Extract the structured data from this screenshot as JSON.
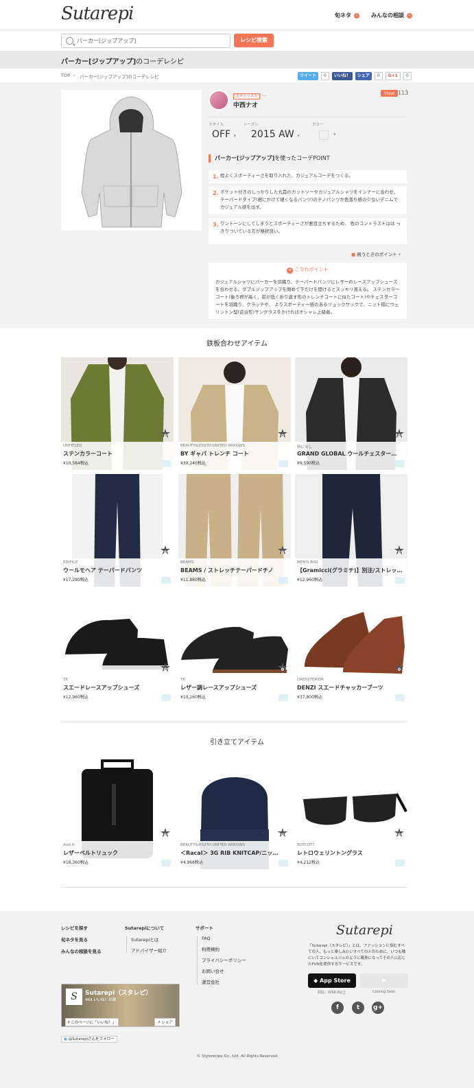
{
  "header": {
    "logo": "Sutarepi",
    "nav": [
      {
        "label": "旬ネタ",
        "icon": "chevron-right-icon"
      },
      {
        "label": "みんなの相談",
        "icon": "chevron-right-icon"
      }
    ]
  },
  "search": {
    "value": "パーカー[ジップアップ]",
    "button": "レシピ検索"
  },
  "band": {
    "bold": "パーカー[ジップアップ]",
    "rest": "のコーデレシピ"
  },
  "breadcrumb": {
    "top": "TOP",
    "sep": "›",
    "current": "パーカー[ジップアップ]のコーデレシピ"
  },
  "social": {
    "tweet": "ツイート",
    "tweet_count": "0",
    "like": "いいね！",
    "share": "シェア",
    "fb_count": "0",
    "gplus": "G+1",
    "gplus_count": "0"
  },
  "stylist": {
    "tag": "スタイリスト",
    "extra": "- -",
    "name": "中西ナオ"
  },
  "view": {
    "label": "View",
    "count": "113"
  },
  "attrs": [
    {
      "label": "スタイル",
      "value": "OFF"
    },
    {
      "label": "シーズン",
      "value": "2015 AW"
    },
    {
      "label": "カラー",
      "value": ""
    }
  ],
  "point": {
    "heading_bold": "パーカー[ジップアップ]",
    "heading_rest": "を使ったコーデPOINT",
    "items": [
      {
        "num": "1.",
        "text": "程よくスポーティーさを取り入れた、カジュアルコーデをつくる。"
      },
      {
        "num": "2.",
        "text": "ポケット付きのしっかりした丸首のカットソーやカジュアルシャツをインナーに合わせ、テーパードタイプ(裾にかけて細くなるパンツ)のチノパンツか色落ち感の少ないデニムで カジュアル感を出す。"
      },
      {
        "num": "3.",
        "text": "ワントーンにしてしまうとスポーティーさが悪目立ちするため、 色のコントラストはは っきりついている方が格好良い。"
      }
    ],
    "buy_point": "買うときのポイント"
  },
  "kodawari": {
    "title": "こなれポイント",
    "text": "カジュアルシャツにパーカーを羽織り、テーパードパンツにレザーのレースアップシューズを合わせる。ダブルジップアップを閉めて下だけを開けるとスッキリ見える。 ステンカラーコート(後ろ襟が高く、前が低く折り返す形のトレンチコートに似たコート)やチェスターコートを羽織り、クラッチや、 よりスポーティー感のあるリュックサックで、ニット帽にウェリントン型(逆台形)サングラスをかければオシャレ上級者。"
  },
  "section1": {
    "title": "鉄板合わせアイテム",
    "items": [
      {
        "brand": "UNTITLED",
        "name": "ステンカラーコート",
        "price": "¥10,584税込",
        "likes": "0"
      },
      {
        "brand": "BEAUTY&YOUTH UNITED ARROWS",
        "name": "BY ギャバ トレンチ コート",
        "price": "¥30,240税込",
        "likes": "0"
      },
      {
        "brand": "特になし",
        "name": "GRAND GLOBAL ウールチェスター…",
        "price": "¥9,590税込",
        "likes": "0"
      },
      {
        "brand": "EDIFICE",
        "name": "ウールモヘア テーパードパンツ",
        "price": "¥17,280税込",
        "likes": "0"
      },
      {
        "brand": "BEAMS",
        "name": "BEAMS / ストレッチテーパードチノ",
        "price": "¥11,880税込",
        "likes": "0"
      },
      {
        "brand": "MEN'S BIGI",
        "name": "【Gramicci(グラミチ)】別注/ストレッチ…",
        "price": "¥12,960税込",
        "likes": "0"
      },
      {
        "brand": "TK",
        "name": "スエードレースアップシューズ",
        "price": "¥12,960税込",
        "likes": "0"
      },
      {
        "brand": "TK",
        "name": "レザー調レースアップシューズ",
        "price": "¥10,260税込",
        "likes": "0"
      },
      {
        "brand": "DRESSTERIOR",
        "name": "DENZI スエードチャッカーブーツ",
        "price": "¥37,800税込",
        "likes": "0"
      }
    ]
  },
  "section2": {
    "title": "引き立てアイテム",
    "items": [
      {
        "brand": "And A",
        "name": "レザーベルトリュック",
        "price": "¥18,360税込",
        "likes": "0"
      },
      {
        "brand": "BEAUTY&YOUTH UNITED ARROWS",
        "name": "＜Racal＞ 3G RIB KNITCAP/ニッ…",
        "price": "¥4,968税込",
        "likes": "0"
      },
      {
        "brand": "BOYCOTT",
        "name": "レトロウェリントングラス",
        "price": "¥4,212税込",
        "likes": "0"
      }
    ]
  },
  "footer": {
    "col1": [
      "レシピを探す",
      "旬ネタを見る",
      "みんなの相談を見る"
    ],
    "col2_title": "Sutarepiについて",
    "col2": [
      "Sutarepiとは",
      "アドバイザー紹介"
    ],
    "col3_title": "サポート",
    "col3": [
      "FAQ",
      "利用規約",
      "プライバシーポリシー",
      "お問い合せ",
      "運営会社"
    ],
    "logo": "Sutarepi",
    "desc": "「Sutarepi（スタレピ）」とは、ファッションに悩むすべての人、もっと楽しみたいすべての人のために、いつも隣にいてコンシェルジュのように親身になってその人に応じたFUNを提供するサービスです。",
    "appstore": "App Store",
    "appstore_note": "対応：iOS6.0以上",
    "gplay_note": "Coming Soon",
    "fb_name": "Sutarepi（スタレピ）",
    "fb_count": "469 いいね！の数",
    "fb_like": "このページに「いいね！」",
    "fb_share": "シェア",
    "twitter_follow": "@Sutarepiさんをフォロー",
    "copyright": "© Stylerecipe Co., Ltd. All Rights Reserved"
  }
}
